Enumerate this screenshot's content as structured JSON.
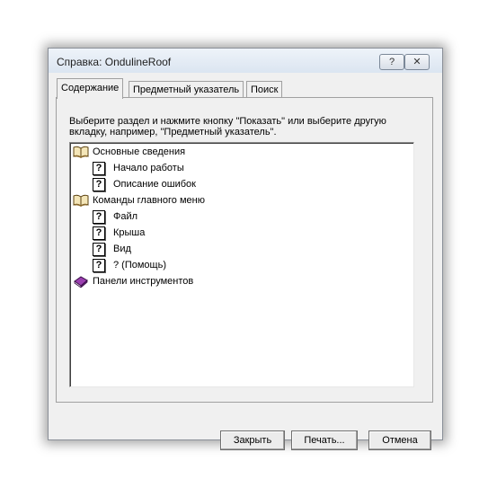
{
  "window": {
    "title": "Справка: OndulineRoof"
  },
  "titlebar": {
    "help_glyph": "?",
    "close_glyph": "✕"
  },
  "tabs": [
    {
      "label": "Содержание",
      "active": true
    },
    {
      "label": "Предметный указатель",
      "active": false
    },
    {
      "label": "Поиск",
      "active": false
    }
  ],
  "instructions": "Выберите раздел и нажмите кнопку \"Показать\" или выберите другую вкладку, например, \"Предметный указатель\".",
  "tree": [
    {
      "label": "Основные сведения",
      "icon": "open-book-icon",
      "level": 0
    },
    {
      "label": "Начало работы",
      "icon": "help-page-icon",
      "level": 1
    },
    {
      "label": "Описание ошибок",
      "icon": "help-page-icon",
      "level": 1
    },
    {
      "label": "Команды главного меню",
      "icon": "open-book-icon",
      "level": 0
    },
    {
      "label": "Файл",
      "icon": "help-page-icon",
      "level": 1
    },
    {
      "label": "Крыша",
      "icon": "help-page-icon",
      "level": 1
    },
    {
      "label": "Вид",
      "icon": "help-page-icon",
      "level": 1
    },
    {
      "label": "? (Помощь)",
      "icon": "help-page-icon",
      "level": 1
    },
    {
      "label": "Панели инструментов",
      "icon": "closed-book-icon",
      "level": 0
    }
  ],
  "icon_glyph": "?",
  "buttons": {
    "close": "Закрыть",
    "print": "Печать...",
    "cancel": "Отмена"
  },
  "colors": {
    "book_open": "#8c6a2c",
    "book_closed": "#7a2a8c"
  }
}
